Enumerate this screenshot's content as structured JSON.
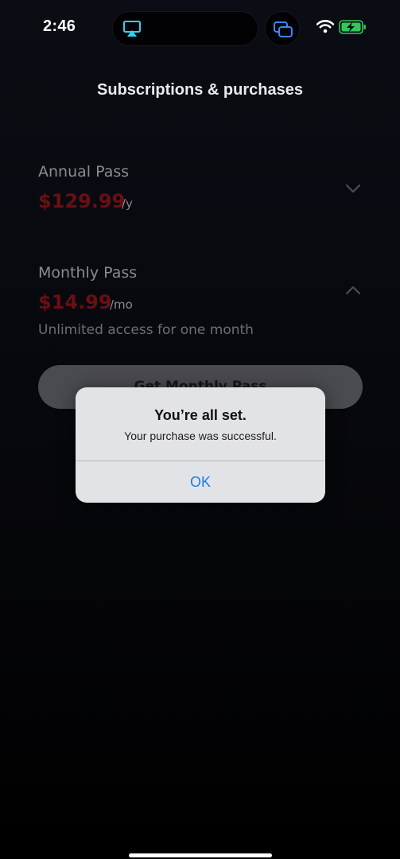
{
  "status_bar": {
    "time": "2:46",
    "icons": [
      "airplay-icon",
      "multitask-icon",
      "wifi-icon",
      "battery-charging-icon"
    ],
    "accent_color": "#2fd3f0",
    "battery_color": "#34c759"
  },
  "page": {
    "title": "Subscriptions & purchases"
  },
  "plans": [
    {
      "name": "Annual Pass",
      "price": "$129.99",
      "period": "/y",
      "expanded": false,
      "chevron": "chevron-down-icon"
    },
    {
      "name": "Monthly Pass",
      "price": "$14.99",
      "period": "/mo",
      "description": "Unlimited access for one month",
      "expanded": true,
      "chevron": "chevron-up-icon"
    }
  ],
  "cta": {
    "label": "Get Monthly Pass"
  },
  "alert": {
    "title": "You’re all set.",
    "message": "Your purchase was successful.",
    "ok_label": "OK",
    "ok_color": "#1a7cf0"
  },
  "colors": {
    "price_accent": "#6a0f12",
    "background": "#000000"
  }
}
